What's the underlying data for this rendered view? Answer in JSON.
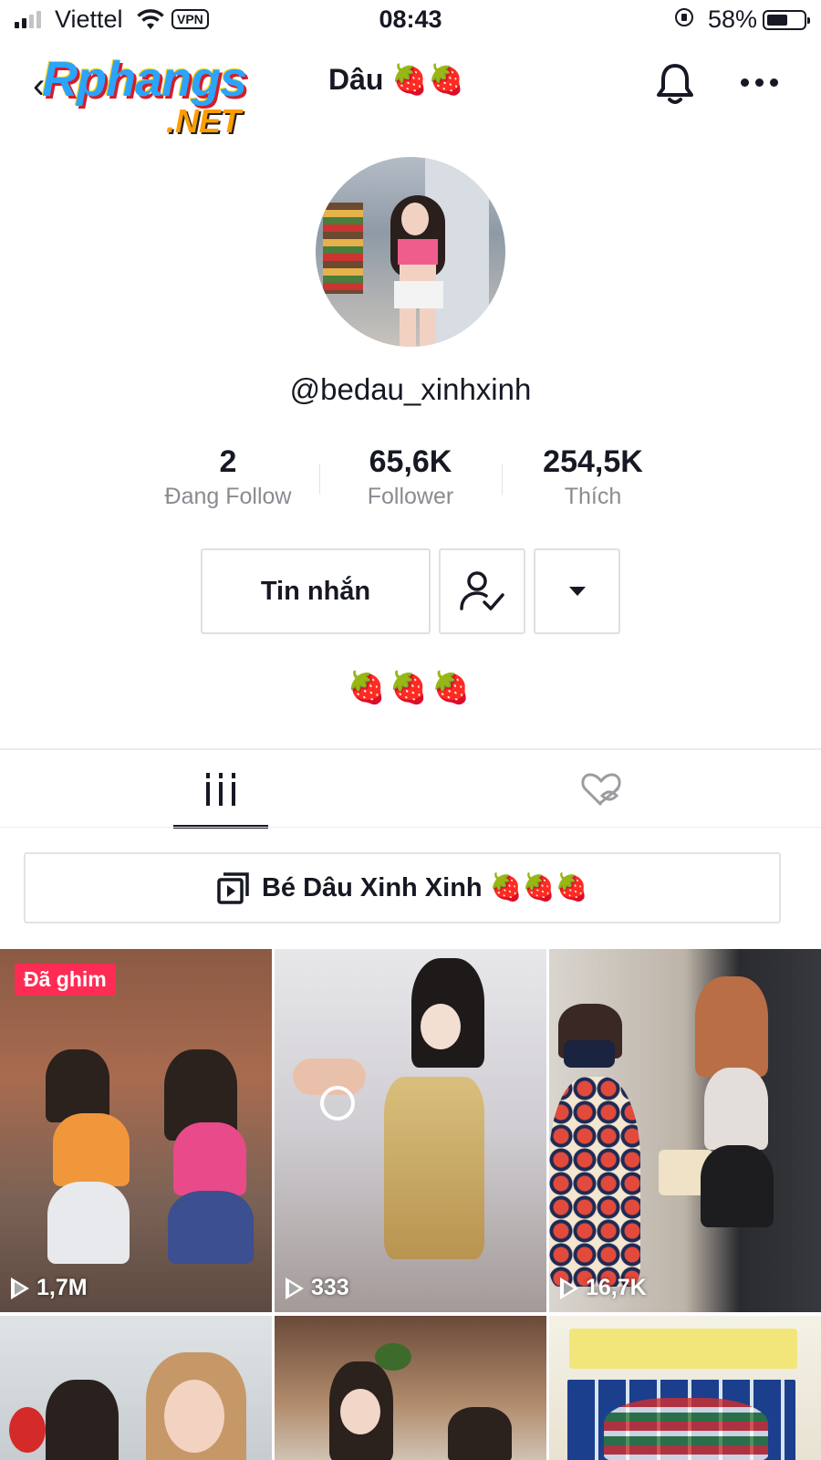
{
  "status_bar": {
    "carrier": "Viettel",
    "vpn": "VPN",
    "time": "08:43",
    "battery": "58%"
  },
  "header": {
    "title": "Dâu 🍓🍓",
    "watermark_text": "Rphangs",
    "watermark_suffix": ".NET"
  },
  "profile": {
    "username": "@bedau_xinhxinh",
    "stats": [
      {
        "value": "2",
        "label": "Đang Follow"
      },
      {
        "value": "65,6K",
        "label": "Follower"
      },
      {
        "value": "254,5K",
        "label": "Thích"
      }
    ],
    "message_button": "Tin nhắn",
    "bio": "🍓🍓🍓"
  },
  "tabs": [
    {
      "icon": "grid-icon",
      "active": true
    },
    {
      "icon": "liked-hidden-icon",
      "active": false
    }
  ],
  "playlist": {
    "label": "Bé Dâu Xinh Xinh 🍓🍓🍓"
  },
  "videos": [
    {
      "pinned_label": "Đã ghim",
      "views": "1,7M"
    },
    {
      "views": "333"
    },
    {
      "views": "16,7K"
    },
    {},
    {},
    {}
  ],
  "colors": {
    "accent": "#fe2c55",
    "text": "#161823",
    "muted": "#8a8b91"
  }
}
